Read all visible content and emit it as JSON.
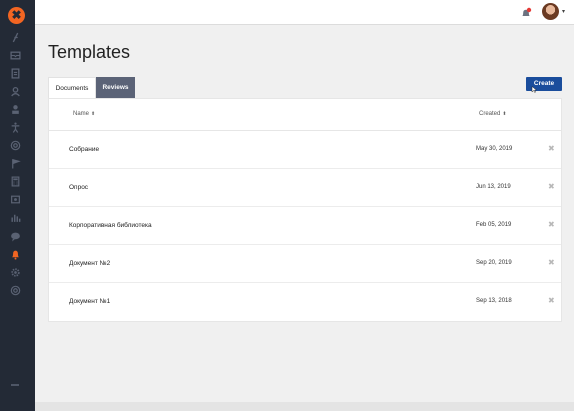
{
  "sidebar": {
    "logo_glyph": "✖",
    "icons": [
      "feather-icon",
      "inbox-icon",
      "document-icon",
      "user-icon",
      "user-outline-icon",
      "accessibility-icon",
      "target-icon",
      "flag-icon",
      "calculator-icon",
      "media-icon",
      "bar-chart-icon",
      "chat-icon",
      "bell-icon",
      "gear-icon",
      "help-icon"
    ],
    "active_icon": "bell-icon",
    "accent_color": "#f26522"
  },
  "page": {
    "title": "Templates"
  },
  "tabs": [
    {
      "label": "Documents",
      "active": true
    },
    {
      "label": "Reviews",
      "active": false
    }
  ],
  "create_button": {
    "label": "Create"
  },
  "table": {
    "columns": {
      "name": "Name",
      "created": "Created",
      "sort_glyph": "⬍"
    },
    "rows": [
      {
        "name": "Собрание",
        "created": "May 30, 2019"
      },
      {
        "name": "Опрос",
        "created": "Jun 13, 2019"
      },
      {
        "name": "Корпоративная библиотека",
        "created": "Feb 05, 2019"
      },
      {
        "name": "Документ №2",
        "created": "Sep 20, 2019"
      },
      {
        "name": "Документ №1",
        "created": "Sep 13, 2018"
      }
    ],
    "delete_glyph": "✖"
  },
  "colors": {
    "sidebar_bg": "#232a36",
    "primary_button": "#1a4d9c",
    "inactive_tab": "#5b6377"
  }
}
